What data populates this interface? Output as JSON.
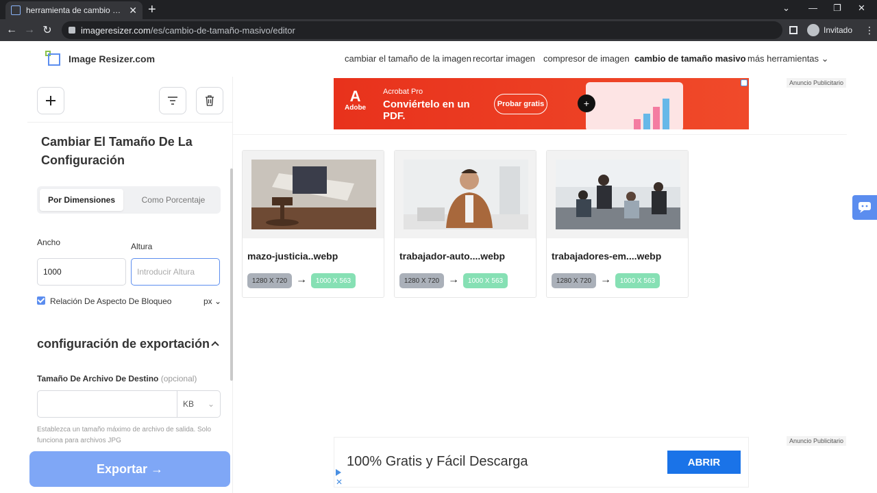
{
  "browser": {
    "tab_title": "herramienta de cambio de tamañ",
    "url_host": "imageresizer.com",
    "url_path": "/es/cambio-de-tamaño-masivo/editor",
    "profile_label": "Invitado"
  },
  "header": {
    "logo_text": "Image Resizer.com",
    "nav": [
      "cambiar el tamaño de la imagen",
      "recortar imagen",
      "compresor de imagen",
      "cambio de tamaño masivo",
      "más herramientas"
    ]
  },
  "sidebar": {
    "section_title": "Cambiar El Tamaño De La Configuración",
    "tab_dimensions": "Por Dimensiones",
    "tab_percent": "Como Porcentaje",
    "width_label": "Ancho",
    "height_label": "Altura",
    "width_value": "1000",
    "height_placeholder": "Introducir Altura",
    "lock_ratio_label": "Relación De Aspecto De Bloqueo",
    "unit": "px",
    "export_settings_title": "configuración de exportación",
    "target_size_label": "Tamaño De Archivo De Destino",
    "optional_label": "(opcional)",
    "size_unit": "KB",
    "hint": "Establezca un tamaño máximo de archivo de salida. Solo funciona para archivos JPG",
    "export_button": "Exportar →"
  },
  "ads": {
    "label": "Anuncio Publicitario",
    "top": {
      "brand": "Adobe",
      "product": "Acrobat Pro",
      "headline": "Conviértelo en un PDF.",
      "cta": "Probar gratis"
    },
    "bottom": {
      "text": "100% Gratis y Fácil Descarga",
      "cta": "ABRIR"
    }
  },
  "files": [
    {
      "name": "mazo-justicia..webp",
      "original": "1280 X 720",
      "resized": "1000 X 563"
    },
    {
      "name": "trabajador-auto....webp",
      "original": "1280 X 720",
      "resized": "1000 X 563"
    },
    {
      "name": "trabajadores-em....webp",
      "original": "1280 X 720",
      "resized": "1000 X 563"
    }
  ]
}
